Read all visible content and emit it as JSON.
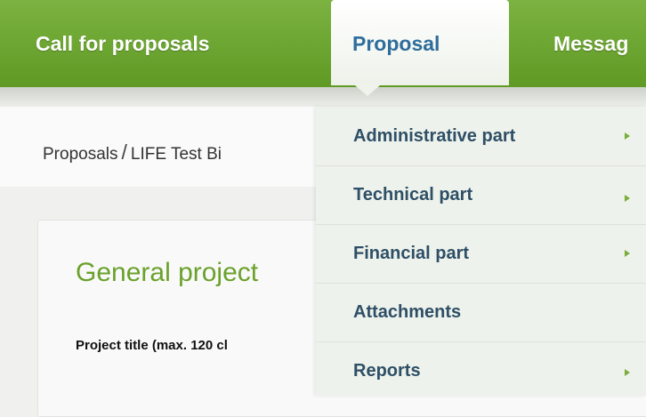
{
  "nav": {
    "items": [
      {
        "label": "Call for proposals"
      },
      {
        "label": "Proposal",
        "active": true
      },
      {
        "label": "Messag"
      }
    ]
  },
  "breadcrumb": {
    "root": "Proposals",
    "separator": "/",
    "current": "LIFE Test Bi"
  },
  "content": {
    "section_title": "General project",
    "field_label": "Project title (max. 120 cl"
  },
  "dropdown": {
    "items": [
      {
        "label": "Administrative part",
        "submenu": true
      },
      {
        "label": "Technical part",
        "submenu": true
      },
      {
        "label": "Financial part",
        "submenu": true
      },
      {
        "label": "Attachments",
        "submenu": false
      },
      {
        "label": "Reports",
        "submenu": true
      }
    ]
  },
  "colors": {
    "nav_green": "#6aa52f",
    "active_text": "#2e6d9c",
    "title_green": "#6aa12b",
    "menu_text": "#2e4f66",
    "arrow_green": "#7aad3a"
  }
}
